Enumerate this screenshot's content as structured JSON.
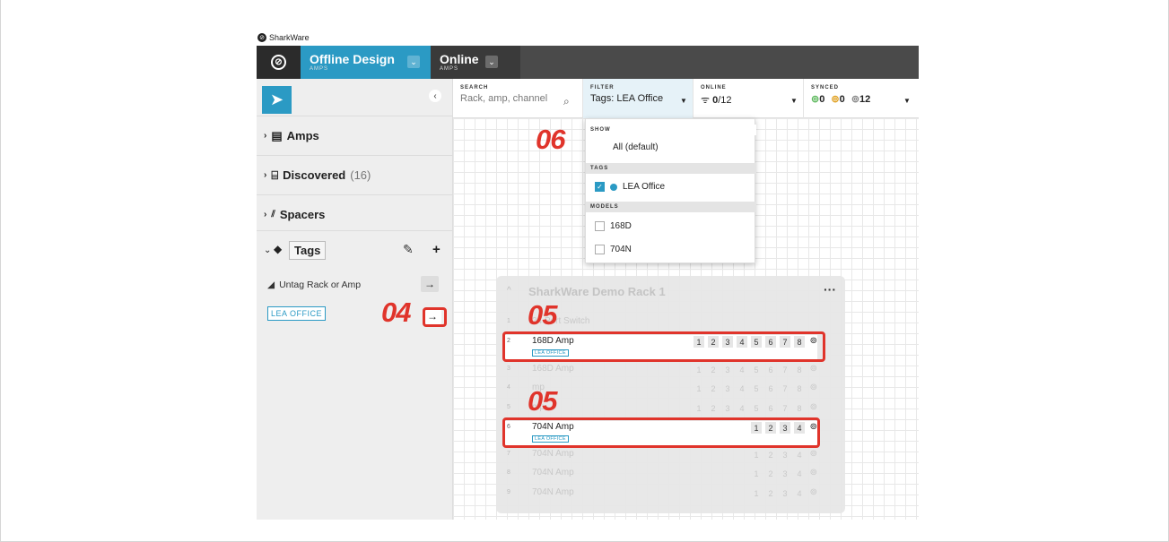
{
  "brand": {
    "name": "SharkWare"
  },
  "tabs": [
    {
      "title": "Offline Design",
      "sub": "AMPS"
    },
    {
      "title": "Online",
      "sub": "AMPS"
    }
  ],
  "sidebar": {
    "sections": [
      {
        "label": "Amps",
        "count": ""
      },
      {
        "label": "Discovered",
        "count": "(16)"
      },
      {
        "label": "Spacers",
        "count": ""
      }
    ],
    "tags_label": "Tags",
    "untag_label": "Untag Rack or Amp",
    "tag_chip": "LEA OFFICE"
  },
  "toolbar": {
    "search": {
      "label": "SEARCH",
      "placeholder": "Rack, amp, channel"
    },
    "filter": {
      "label": "FILTER",
      "value": "Tags: LEA Office"
    },
    "online": {
      "label": "ONLINE",
      "value": "0",
      "total": "/12"
    },
    "synced": {
      "label": "SYNCED",
      "a": "0",
      "b": "0",
      "c": "12"
    }
  },
  "filter_dropdown": {
    "show_head": "SHOW",
    "show_default": "All (default)",
    "tags_head": "TAGS",
    "tag_item": "LEA Office",
    "models_head": "MODELS",
    "model_1": "168D",
    "model_2": "704N"
  },
  "rack": {
    "title": "SharkWare Demo Rack 1",
    "rows": [
      {
        "idx": "1",
        "name": "24 Port Switch",
        "channels": []
      },
      {
        "idx": "2",
        "name": "168D Amp",
        "channels": [
          "1",
          "2",
          "3",
          "4",
          "5",
          "6",
          "7",
          "8"
        ],
        "tag": "LEA OFFICE"
      },
      {
        "idx": "3",
        "name": "168D Amp",
        "channels": [
          "1",
          "2",
          "3",
          "4",
          "5",
          "6",
          "7",
          "8"
        ]
      },
      {
        "idx": "4",
        "name": "mp",
        "channels": [
          "1",
          "2",
          "3",
          "4",
          "5",
          "6",
          "7",
          "8"
        ]
      },
      {
        "idx": "5",
        "name": "mp",
        "channels": [
          "1",
          "2",
          "3",
          "4",
          "5",
          "6",
          "7",
          "8"
        ]
      },
      {
        "idx": "6",
        "name": "704N Amp",
        "channels": [
          "1",
          "2",
          "3",
          "4"
        ],
        "tag": "LEA OFFICE"
      },
      {
        "idx": "7",
        "name": "704N Amp",
        "channels": [
          "1",
          "2",
          "3",
          "4"
        ]
      },
      {
        "idx": "8",
        "name": "704N Amp",
        "channels": [
          "1",
          "2",
          "3",
          "4"
        ]
      },
      {
        "idx": "9",
        "name": "704N Amp",
        "channels": [
          "1",
          "2",
          "3",
          "4"
        ]
      }
    ]
  },
  "callouts": {
    "c04": "04",
    "c05a": "05",
    "c05b": "05",
    "c06": "06"
  },
  "colors": {
    "accent": "#2b9ac4",
    "callout": "#e0342b",
    "topbar": "#4a4a4a"
  }
}
